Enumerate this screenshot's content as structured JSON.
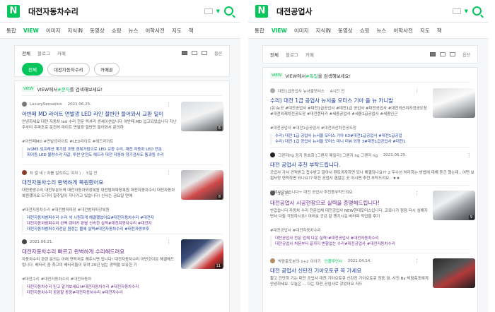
{
  "panels": [
    {
      "query": "대전자동차수리",
      "tabs": [
        "통합",
        "VIEW",
        "이미지",
        "지식iN",
        "동영상",
        "쇼핑",
        "뉴스",
        "어학사전",
        "지도",
        "책"
      ],
      "filters": [
        "전체",
        "블로그",
        "카페"
      ],
      "options_label": "옵션",
      "chips": [
        "전체",
        "대전자동차수리",
        "카페골"
      ],
      "hint": {
        "prefix": "VIEW에서 ",
        "keyword": "#쿤자",
        "suffix": "를 검색해보세요!"
      },
      "posts": [
        {
          "author": "LuxurySensation",
          "date": "2021.06.25.",
          "title": "아반떼 MD 라이트 면발광 LED 라인 절반만 들어와서 교환 일이",
          "desc": "안녕하세요 대전 자동차 led 수리 전문 럭셔리 센세이션입니다 아반떼 MD 입고되었습니다 지난주부터 주파조로 운전석 라이트 면발광 절반만 들어와서 문의하",
          "tags": "#아반떼MD  #면발광라이트  #LED라이트  #헤드라이트",
          "visited": false,
          "sub": [
            {
              "t": "뉴SM5 임프레션 계기판 조명 경복거림으로 LED 교환 수리, 대전 자동차 LED 전문",
              "vis": false
            },
            {
              "t": "휘어등 LED 불량수리 자값, 투싼 안전도 헤드라 대전 자동차 정기검사도 통과됨 수리",
              "vis": false
            }
          ],
          "image_count": "6"
        },
        {
          "author": "차 열 네 ( 차를 알려주는 여자 )",
          "date": "5일 전",
          "title": "대전자동차수리 완벽하게 복원했어요",
          "desc": "대전동방수리 대전부분도색 대전자동차외장복원 대전범퍼파장복원 대전자동차수리 대전자동차 복원했어요 드디어 칠주일이 지나가고 있습니다! 신사는 금요일 연에",
          "tags": "#대전자동차수리  #대전범퍼파장  #대전범퍼파장복원",
          "visited": false,
          "sub": [
            {
              "t": "대전자동차범퍼수리 수리 석 시원하게 해결했었어요#대전자동차수리 #대전자",
              "vis": false
            },
            {
              "t": "대전자동차범퍼수리 완벽 렌터카 판별 신속한 실력#대전자동차수리 #대전자",
              "vis": true
            },
            {
              "t": "대전자동차범퍼수리전문 원정는 볼에 실력#대전자동차수리 #대전자량부후",
              "vis": false
            }
          ],
          "image_count": "8"
        },
        {
          "author": "",
          "date": "2021.06.21.",
          "title": "대전자동차수리 빠르고 완벽하게 수리해드려요",
          "desc": "자동차수리 관련 문의는 아래 연락처로 해주시면 됩니다! 대전자동차수리 어떤것이든 해결해드립니다. 배터리 중 최고의 배터리들이 모여 20년 넘는 경력을 보유한 기",
          "tags": "#대전수리  #대전자동차수리  #대전자동차",
          "visited": true,
          "sub": [
            {
              "t": "대전자동차수리 믿고 맡겨보세요!#대전자동차수리 #대전자동차수리",
              "vis": true
            },
            {
              "t": "대전자동차수리 꼼꼼할 동장#대전자동차수리 #대전자수리",
              "vis": true
            }
          ],
          "image_count": "11"
        }
      ]
    },
    {
      "query": "대전공업사",
      "tabs": [
        "통합",
        "VIEW",
        "이미지",
        "지식iN",
        "동영상",
        "쇼핑",
        "뉴스",
        "어학사전",
        "지도",
        "책"
      ],
      "filters": [
        "전체",
        "블로그",
        "카페"
      ],
      "options_label": "옵션",
      "chips": [],
      "hint": {
        "prefix": "VIEW에서 ",
        "keyword": "#독일",
        "suffix": "을 검색해보세요!"
      },
      "posts": [
        {
          "author": "대전1급공업사 뉴서울모터스",
          "date": "4시간 전",
          "title": "수리) 대전 1급 공업사 뉴서울 모터스 기아 올 뉴 카니발",
          "desc": "(유)뉴모 #대전공업사 #대전1급공업사 #대전1급 공업사 #대전공업사 #대전외산차자전공도장 #대전외제차전공도장 #대전렌터카 #세종공업사 #세종1급공업사 #세종인근",
          "tags": "#대전공업사  #대전1급공업사  #대전외산차전공도장",
          "visited": false,
          "sub": [
            {
              "t": "수리) 대전 1급 공업사 뉴서울 모터스 기아 K3#대전1급공업사 #대전1급공업",
              "vis": false
            },
            {
              "t": "수리) 대전 1급 공업사 뉴서울 모터스 미니 터뷰 외장 3#대전1급공업사 #대전1",
              "vis": false
            }
          ],
          "image_count": ""
        },
        {
          "author": "그랜저Hg 꽁지 동호회 [그랜저 패밀리] 그랜저 hg 그랜저 hg",
          "date": "2021.06.25.",
          "title": "대전 공업사 추천 부탁드립니다.",
          "desc": "공업사 가서 견적받고 접수받고 알아서 렌트까자하면 되나 해결되나요?? 2 두수선 처리하는 방법에 대해 듣긴 했는데.. 어떤 보험사랑 연락하면 되나요?? 대전 공업사 괜찮은 곳 아시면 추천 부탁드려요.. ★★",
          "tags": "어제사고났습니다ㅜ 대전 공업사 추천좀부탁드려요",
          "visited": false,
          "sub": [],
          "image_count": ""
        },
        {
          "author": "",
          "date": "3일 전",
          "title": "대전공업사 시공현장으로 실력을 증명해드립니다!",
          "desc": "반갑습니다 자동차 수리 전문업체 대전공업사 NEW현대모터스입니다. 코로나가 점점 다시 심해지면서 다들 걱정하시죠? 여러분 건강 잘 챙기시길 바라며 작업을 후기",
          "tags": "#대전공업사  #대전자동차수리",
          "visited": true,
          "sub": [
            {
              "t": "대전공업사 전문 업체 다운 실력!#대전공업사 #대전자동차수리",
              "vis": true
            },
            {
              "t": "대전공업사 처음부터 끝까지 변함없는 수리#대전공업사 #대전자동차수리",
              "vis": true
            }
          ],
          "image_count": "9"
        },
        {
          "author": "박람출포본의 1+2 이야기",
          "date": "2021.04.14.",
          "title": "대전 공업사 신탄진 기아오토큐 꼭 가세요",
          "desc": "짧고 간단하 기는 대전 공업사 대전 기아오토큐 신탄진 기아오토큐 정중 겸, 사진 By 박람축포에게 안녕하세요. 오늘은 ... 다는 대전 공업사로 갔었어요 저드",
          "tags": "",
          "visited": false,
          "sub": [],
          "image_count": ""
        }
      ]
    }
  ],
  "colors": {
    "brand": "#03c75a",
    "link": "#1d3ea3",
    "visited": "#6d2c91"
  }
}
